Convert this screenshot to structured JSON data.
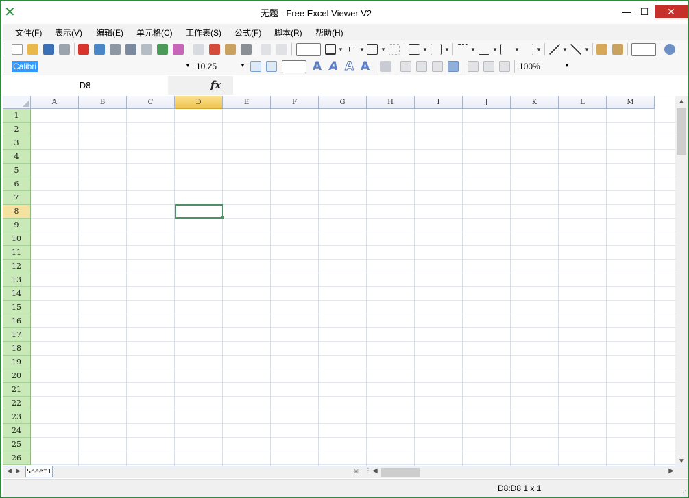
{
  "window": {
    "title": "无题 - Free Excel Viewer V2",
    "app_icon": "excel-x-icon",
    "controls": {
      "minimize": "—",
      "maximize": "☐",
      "close": "✕"
    }
  },
  "menu": [
    {
      "label": "文件(F)"
    },
    {
      "label": "表示(V)"
    },
    {
      "label": "编辑(E)"
    },
    {
      "label": "单元格(C)"
    },
    {
      "label": "工作表(S)"
    },
    {
      "label": "公式(F)"
    },
    {
      "label": "脚本(R)"
    },
    {
      "label": "帮助(H)"
    }
  ],
  "format_toolbar": {
    "font_name": "Calibri",
    "font_size": "10.25",
    "zoom": "100%"
  },
  "formula_bar": {
    "cell_reference": "D8",
    "fx_label": "fx",
    "formula_value": ""
  },
  "grid": {
    "columns": [
      "A",
      "B",
      "C",
      "D",
      "E",
      "F",
      "G",
      "H",
      "I",
      "J",
      "K",
      "L",
      "M"
    ],
    "rows": [
      "1",
      "2",
      "3",
      "4",
      "5",
      "6",
      "7",
      "8",
      "9",
      "10",
      "11",
      "12",
      "13",
      "14",
      "15",
      "16",
      "17",
      "18",
      "19",
      "20",
      "21",
      "22",
      "23",
      "24",
      "25",
      "26"
    ],
    "selected_column": "D",
    "selected_row": "8"
  },
  "sheets": {
    "tabs": [
      {
        "label": "Sheet1"
      }
    ],
    "active": "Sheet1"
  },
  "status": {
    "selection": "D8:D8 1 x 1"
  },
  "colors": {
    "window_border": "#2e8b3e",
    "row_header": "#c9e9b8",
    "selected_header": "#eec552",
    "active_cell_border": "#4f8f67",
    "close_button": "#c7302a"
  }
}
